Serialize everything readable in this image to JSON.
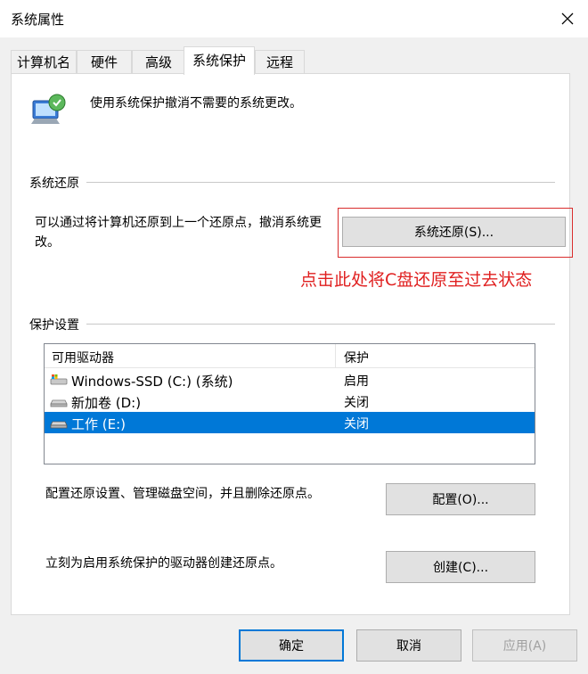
{
  "window": {
    "title": "系统属性"
  },
  "tabs": [
    {
      "label": "计算机名"
    },
    {
      "label": "硬件"
    },
    {
      "label": "高级"
    },
    {
      "label": "系统保护"
    },
    {
      "label": "远程"
    }
  ],
  "active_tab": "系统保护",
  "intro": {
    "text": "使用系统保护撤消不需要的系统更改。",
    "icon": "system-protection-icon"
  },
  "restore_group": {
    "label": "系统还原",
    "description": "可以通过将计算机还原到上一个还原点，撤消系统更改。",
    "button_label": "系统还原(S)..."
  },
  "annotation": {
    "text": "点击此处将C盘还原至过去状态",
    "color": "#e02020"
  },
  "protection_group": {
    "label": "保护设置",
    "columns": [
      "可用驱动器",
      "保护"
    ],
    "drives": [
      {
        "name": "Windows-SSD (C:) (系统)",
        "protection": "启用",
        "icon": "system-drive-icon",
        "selected": false
      },
      {
        "name": "新加卷 (D:)",
        "protection": "关闭",
        "icon": "drive-icon",
        "selected": false
      },
      {
        "name": "工作 (E:)",
        "protection": "关闭",
        "icon": "drive-icon",
        "selected": true
      }
    ],
    "configure_text": "配置还原设置、管理磁盘空间，并且删除还原点。",
    "configure_button": "配置(O)...",
    "create_text": "立刻为启用系统保护的驱动器创建还原点。",
    "create_button": "创建(C)..."
  },
  "footer": {
    "ok": "确定",
    "cancel": "取消",
    "apply": "应用(A)"
  },
  "colors": {
    "selection": "#0078d7",
    "accent": "#0078d7",
    "annotation_red": "#e02020"
  }
}
